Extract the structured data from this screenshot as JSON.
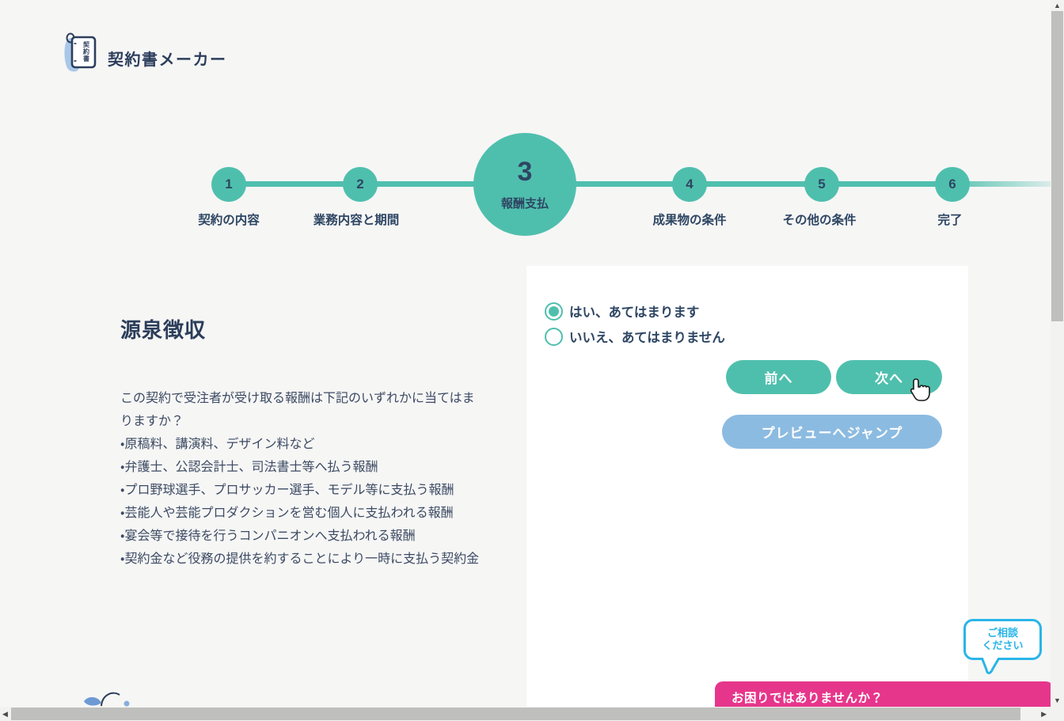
{
  "brand": {
    "name": "契約書メーカー",
    "logo_char1": "契",
    "logo_char2": "約",
    "logo_char3": "書"
  },
  "stepper": {
    "steps": [
      {
        "number": "1",
        "label": "契約の内容"
      },
      {
        "number": "2",
        "label": "業務内容と期間"
      },
      {
        "number": "3",
        "label": "報酬支払"
      },
      {
        "number": "4",
        "label": "成果物の条件"
      },
      {
        "number": "5",
        "label": "その他の条件"
      },
      {
        "number": "6",
        "label": "完了"
      }
    ],
    "current_step": "3"
  },
  "question": {
    "title": "源泉徴収",
    "intro": "この契約で受注者が受け取る報酬は下記のいずれかに当てはまりますか？",
    "bullets": [
      "・原稿料、講演料、デザイン料など",
      "・弁護士、公認会計士、司法書士等へ払う報酬",
      "・プロ野球選手、プロサッカー選手、モデル等に支払う報酬",
      "・芸能人や芸能プロダクションを営む個人に支払われる報酬",
      "・宴会等で接待を行うコンパニオンへ支払われる報酬",
      "・契約金など役務の提供を約することにより一時に支払う契約金"
    ]
  },
  "options": [
    {
      "label": "はい、あてはまります",
      "selected": true
    },
    {
      "label": "いいえ、あてはまりません",
      "selected": false
    }
  ],
  "buttons": {
    "prev": "前へ",
    "next": "次へ",
    "preview": "プレビューへジャンプ"
  },
  "help": {
    "bubble_line1": "ご相談",
    "bubble_line2": "ください",
    "bar_text": "お困りではありませんか？"
  },
  "colors": {
    "accent_teal": "#4fbfad",
    "navy_text": "#2e4663",
    "preview_blue": "#8cbbe1",
    "help_pink": "#e6368b",
    "bubble_cyan": "#29b5e8",
    "page_bg": "#f6f6f5"
  }
}
